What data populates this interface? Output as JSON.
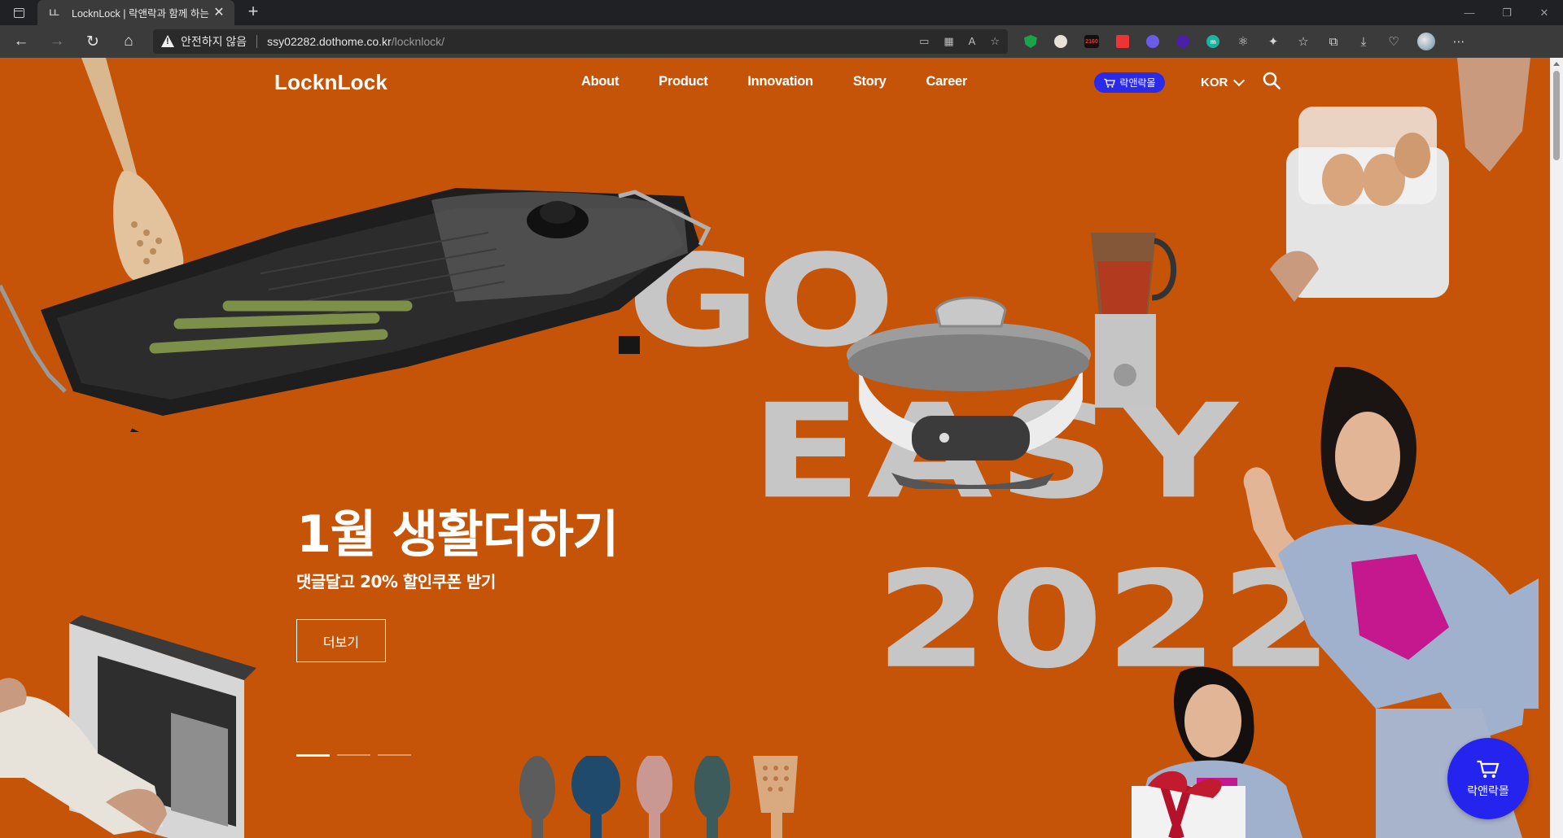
{
  "browser": {
    "tab_title": "LocknLock | 락앤락과 함께 하는",
    "tab_favicon": "LL",
    "security_label": "안전하지 않음",
    "url_host": "ssy02282.dothome.co.kr",
    "url_path": "/locknlock/",
    "ext_badge": "2160",
    "ext_m": "m"
  },
  "site": {
    "logo": "LocknLock",
    "nav": [
      "About",
      "Product",
      "Innovation",
      "Story",
      "Career"
    ],
    "mall_label": "락앤락몰",
    "language": "KOR",
    "accent_color": "#c65408",
    "mall_color": "#2a2ae8"
  },
  "hero": {
    "title": "1월 생활더하기",
    "subtitle": "댓글달고 20% 할인쿠폰 받기",
    "button": "더보기",
    "slides_total": 3,
    "slide_active": 1,
    "graphic_go": "GO",
    "graphic_easy": "EASY",
    "graphic_year": "2022"
  },
  "floating_mall": {
    "label": "락앤락몰"
  }
}
